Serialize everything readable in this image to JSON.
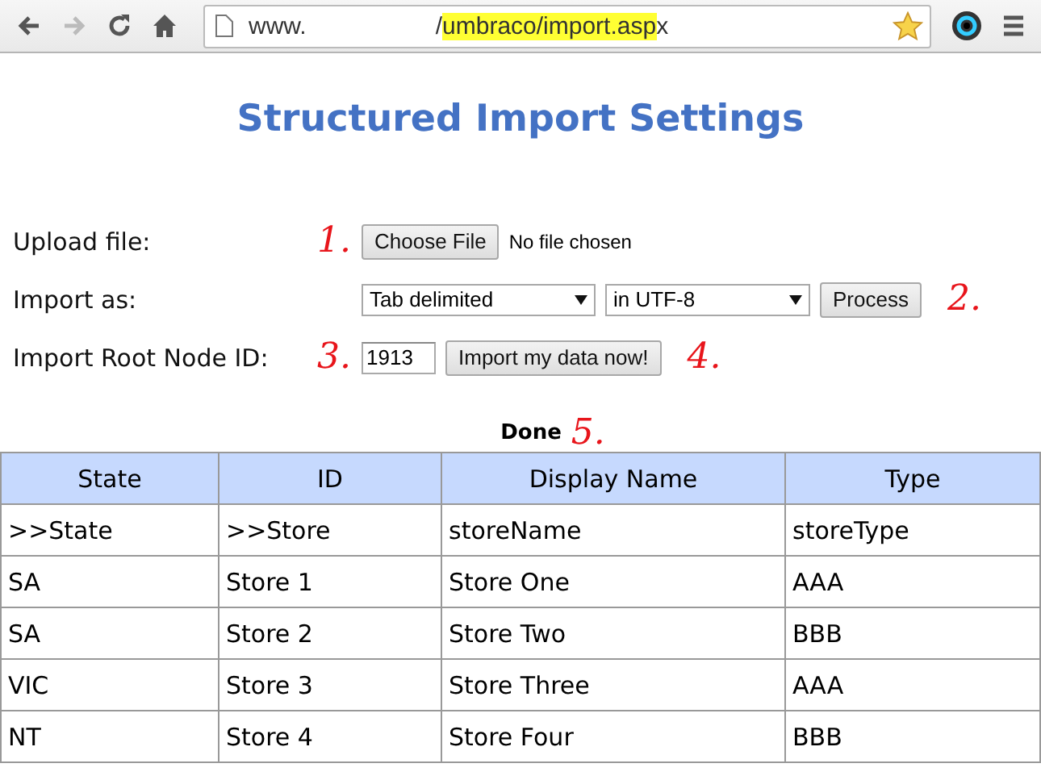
{
  "browser": {
    "url_start": "www.",
    "url_gap": "/",
    "url_highlight": "umbraco/import.asp",
    "url_end": "x"
  },
  "page_title": "Structured Import Settings",
  "form_rows": [
    {
      "label": "Upload file:",
      "note_before": "1.",
      "controls": [
        {
          "kind": "button",
          "text": "Choose File"
        },
        {
          "kind": "status",
          "text": "No file chosen"
        }
      ]
    },
    {
      "label": "Import as:",
      "controls": [
        {
          "kind": "select",
          "text": "Tab delimited"
        },
        {
          "kind": "select",
          "text": "in UTF-8"
        },
        {
          "kind": "button",
          "text": "Process"
        }
      ],
      "note_after": "2."
    },
    {
      "label": "Import Root Node ID:",
      "note_before": "3.",
      "controls": [
        {
          "kind": "input",
          "text": "1913"
        },
        {
          "kind": "button",
          "text": "Import my data now!"
        }
      ],
      "note_after": "4."
    }
  ],
  "status": {
    "text": "Done",
    "note": "5."
  },
  "table": {
    "columns": [
      "State",
      "ID",
      "Display Name",
      "Type"
    ],
    "rows": [
      [
        ">>State",
        ">>Store",
        "storeName",
        "storeType"
      ],
      [
        "SA",
        "Store 1",
        "Store One",
        "AAA"
      ],
      [
        "SA",
        "Store 2",
        "Store Two",
        "BBB"
      ],
      [
        "VIC",
        "Store 3",
        "Store Three",
        "AAA"
      ],
      [
        "NT",
        "Store 4",
        "Store Four",
        "BBB"
      ]
    ]
  }
}
